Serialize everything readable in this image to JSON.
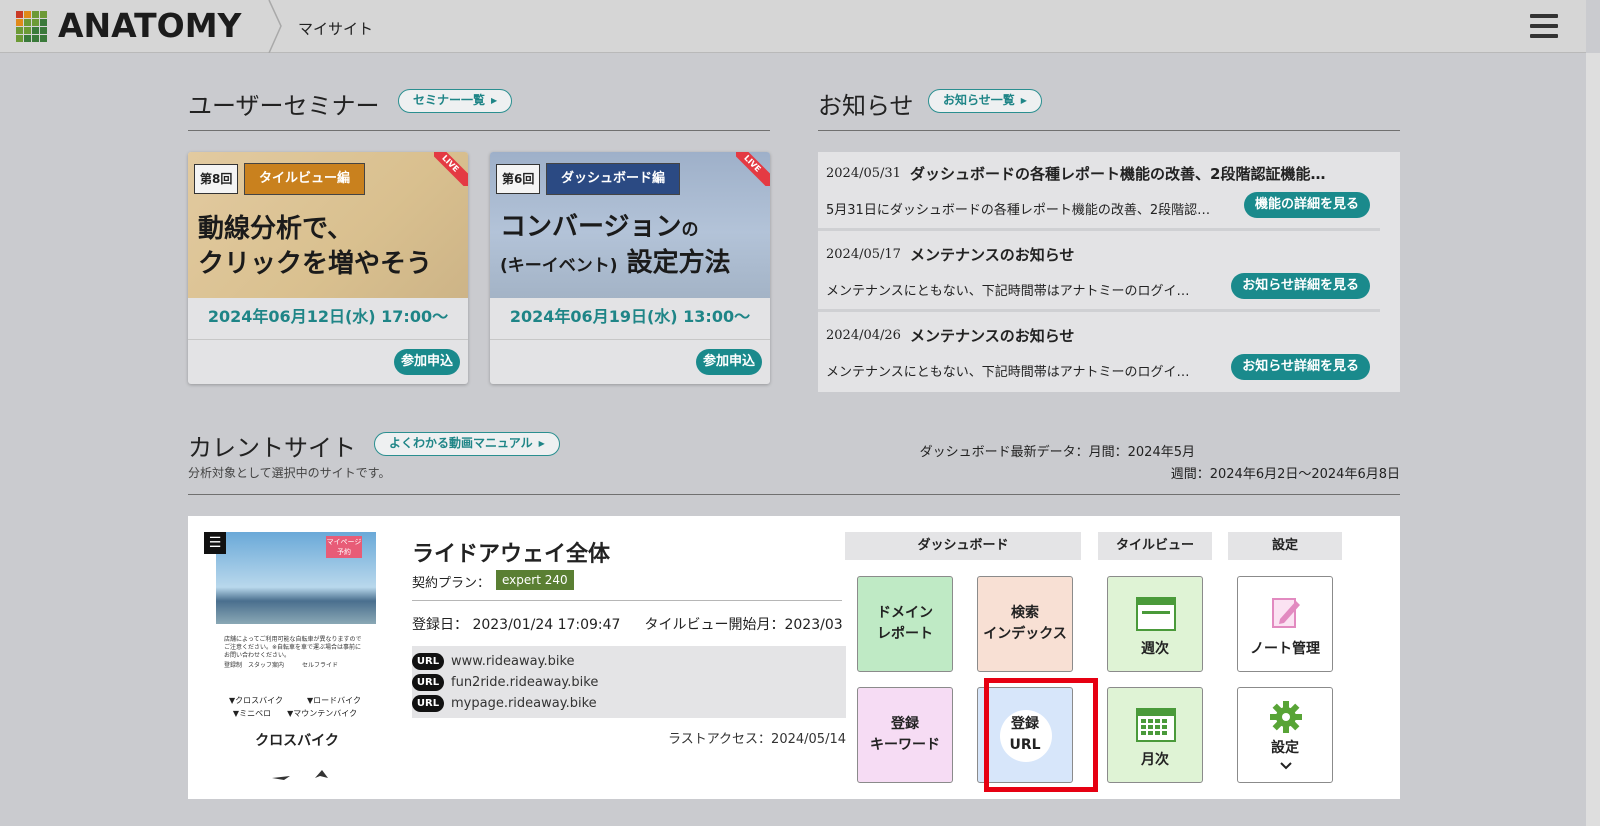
{
  "header": {
    "brand": "ANATOMY",
    "breadcrumb": "マイサイト",
    "logo_colors": [
      "#c93a27",
      "#e08a1a",
      "#6c9a35",
      "#3a7a3a"
    ]
  },
  "seminar_section": {
    "title": "ユーザーセミナー",
    "list_link": "セミナー一覧",
    "cards": [
      {
        "number": "第8回",
        "category": "タイルビュー編",
        "category_color": "#c9811e",
        "headline_line1": "動線分析で、",
        "headline_line2": "クリックを増やそう",
        "date": "2024年06月12日(水) 17:00～",
        "apply_label": "参加申込",
        "live": "LIVE"
      },
      {
        "number": "第6回",
        "category": "ダッシュボード編",
        "category_color": "#2b4a83",
        "headline_line1_main": "コンバージョン",
        "headline_line1_small": "の",
        "headline_line2_small": "(キーイベント)",
        "headline_line2_main": "設定方法",
        "date": "2024年06月19日(水) 13:00～",
        "apply_label": "参加申込",
        "live": "LIVE"
      }
    ]
  },
  "news_section": {
    "title": "お知らせ",
    "list_link": "お知らせ一覧",
    "items": [
      {
        "date": "2024/05/31",
        "title": "ダッシュボードの各種レポート機能の改善、2段階認証機能…",
        "desc": "5月31日にダッシュボードの各種レポート機能の改善、2段階認…",
        "button": "機能の詳細を見る"
      },
      {
        "date": "2024/05/17",
        "title": "メンテナンスのお知らせ",
        "desc": "メンテナンスにともない、下記時間帯はアナトミーのログイ…",
        "button": "お知らせ詳細を見る"
      },
      {
        "date": "2024/04/26",
        "title": "メンテナンスのお知らせ",
        "desc": "メンテナンスにともない、下記時間帯はアナトミーのログイ…",
        "button": "お知らせ詳細を見る"
      }
    ]
  },
  "current_site": {
    "title": "カレントサイト",
    "manual_link": "よくわかる動画マニュアル",
    "subtitle": "分析対象として選択中のサイトです。",
    "dashboard_data_monthly": "ダッシュボード最新データ：月間：2024年5月",
    "dashboard_data_weekly": "週間：2024年6月2日～2024年6月8日",
    "site_name": "ライドアウェイ全体",
    "plan_label": "契約プラン：",
    "plan": "expert 240",
    "registered": "登録日： 2023/01/24 17:09:47",
    "tileview_start": "タイルビュー開始月：2023/03",
    "url_tag": "URL",
    "urls": [
      "www.rideaway.bike",
      "fun2ride.rideaway.bike",
      "mypage.rideaway.bike"
    ],
    "last_access": "ラストアクセス：2024/05/14",
    "thumbnail": {
      "menu_glyph": "☰",
      "mypage_line1": "マイページ",
      "mypage_line2": "予約",
      "fine_print": "店舗によってご利用可能な自転車が異なりますのでご注意ください。※自転車を車で運ぶ場合は事前にお問い合わせください。",
      "legend": "登録制　スタッフ案内　　　セルフライド",
      "link1": "▼クロスバイク　　　▼ロードバイク",
      "link2": "▼ミニベロ　　▼マウンテンバイク",
      "category": "クロスバイク"
    },
    "columns": {
      "dashboard": "ダッシュボード",
      "tileview": "タイルビュー",
      "settings": "設定"
    },
    "tiles": {
      "domain_report_1": "ドメイン",
      "domain_report_2": "レポート",
      "search_index_1": "検索",
      "search_index_2": "インデックス",
      "keywords_1": "登録",
      "keywords_2": "キーワード",
      "reg_url_1": "登録",
      "reg_url_2": "URL",
      "weekly": "週次",
      "monthly": "月次",
      "notes": "ノート管理",
      "settings": "設定"
    }
  }
}
